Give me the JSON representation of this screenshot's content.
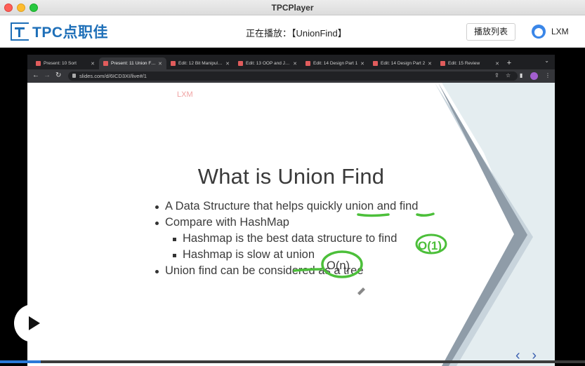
{
  "window": {
    "title": "TPCPlayer"
  },
  "app": {
    "logo_text": "TPC点职佳",
    "now_playing": "正在播放：【UnionFind】",
    "playlist_button": "播放列表",
    "user_name": "LXM"
  },
  "browser": {
    "tabs": [
      {
        "label": "Present: 10 Sort",
        "active": false
      },
      {
        "label": "Present: 11 Union Find",
        "active": true
      },
      {
        "label": "Edit: 12 Bit Manipulation",
        "active": false
      },
      {
        "label": "Edit: 13 OOP and Java",
        "active": false
      },
      {
        "label": "Edit: 14 Design Part 1",
        "active": false
      },
      {
        "label": "Edit: 14 Design Part 2",
        "active": false
      },
      {
        "label": "Edit: 15 Review",
        "active": false
      }
    ],
    "close_glyph": "✕",
    "url": "slides.com/d/6ICD3XI/live#/1"
  },
  "slide": {
    "watermark": "LXM",
    "title": "What is Union Find",
    "bullets": [
      {
        "text": "A Data Structure that helps quickly union and find",
        "level": 1
      },
      {
        "text": "Compare with HashMap",
        "level": 1
      },
      {
        "text": "Hashmap is the best data structure to find",
        "level": 2
      },
      {
        "text": "Hashmap is slow at union",
        "level": 2
      },
      {
        "text": "Union find can be considered as a tree",
        "level": 1
      }
    ],
    "annotations": {
      "find_cost": "O(1)",
      "union_cost": "O(n)"
    }
  },
  "player": {
    "progress_percent": 7
  },
  "colors": {
    "brand": "#1e6fb8",
    "ink": "#4cbf3a",
    "accent": "#3a5fb0"
  }
}
